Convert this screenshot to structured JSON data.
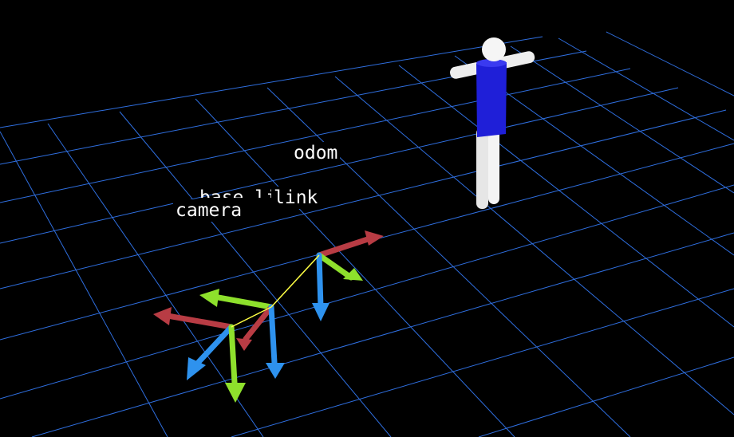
{
  "viewer": {
    "frames": [
      {
        "id": "odom",
        "label": "odom"
      },
      {
        "id": "base_link",
        "label": "base_link",
        "visible_fragment": "link"
      },
      {
        "id": "camera",
        "label": "camera"
      }
    ],
    "grid_color": "#2f6fe0",
    "background_color": "#000000",
    "connector_color": "#ffff44",
    "axis_colors": {
      "x": "#b83c44",
      "y": "#8ee02c",
      "z": "#2e92ee"
    },
    "figure": {
      "body_color": "#1f1fd8",
      "limb_color": "#f2f2f2"
    }
  }
}
